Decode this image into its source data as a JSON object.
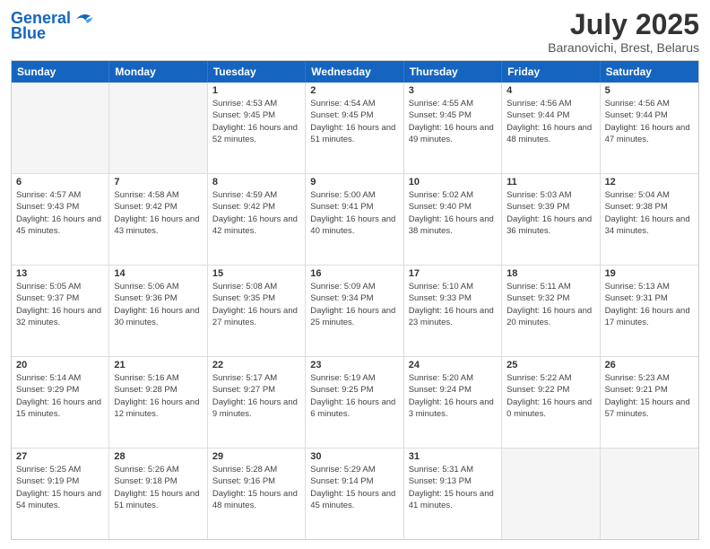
{
  "header": {
    "logo_line1": "General",
    "logo_line2": "Blue",
    "title": "July 2025",
    "subtitle": "Baranovichi, Brest, Belarus"
  },
  "weekdays": [
    "Sunday",
    "Monday",
    "Tuesday",
    "Wednesday",
    "Thursday",
    "Friday",
    "Saturday"
  ],
  "rows": [
    [
      {
        "day": "",
        "sunrise": "",
        "sunset": "",
        "daylight": "",
        "empty": true
      },
      {
        "day": "",
        "sunrise": "",
        "sunset": "",
        "daylight": "",
        "empty": true
      },
      {
        "day": "1",
        "sunrise": "Sunrise: 4:53 AM",
        "sunset": "Sunset: 9:45 PM",
        "daylight": "Daylight: 16 hours and 52 minutes."
      },
      {
        "day": "2",
        "sunrise": "Sunrise: 4:54 AM",
        "sunset": "Sunset: 9:45 PM",
        "daylight": "Daylight: 16 hours and 51 minutes."
      },
      {
        "day": "3",
        "sunrise": "Sunrise: 4:55 AM",
        "sunset": "Sunset: 9:45 PM",
        "daylight": "Daylight: 16 hours and 49 minutes."
      },
      {
        "day": "4",
        "sunrise": "Sunrise: 4:56 AM",
        "sunset": "Sunset: 9:44 PM",
        "daylight": "Daylight: 16 hours and 48 minutes."
      },
      {
        "day": "5",
        "sunrise": "Sunrise: 4:56 AM",
        "sunset": "Sunset: 9:44 PM",
        "daylight": "Daylight: 16 hours and 47 minutes."
      }
    ],
    [
      {
        "day": "6",
        "sunrise": "Sunrise: 4:57 AM",
        "sunset": "Sunset: 9:43 PM",
        "daylight": "Daylight: 16 hours and 45 minutes."
      },
      {
        "day": "7",
        "sunrise": "Sunrise: 4:58 AM",
        "sunset": "Sunset: 9:42 PM",
        "daylight": "Daylight: 16 hours and 43 minutes."
      },
      {
        "day": "8",
        "sunrise": "Sunrise: 4:59 AM",
        "sunset": "Sunset: 9:42 PM",
        "daylight": "Daylight: 16 hours and 42 minutes."
      },
      {
        "day": "9",
        "sunrise": "Sunrise: 5:00 AM",
        "sunset": "Sunset: 9:41 PM",
        "daylight": "Daylight: 16 hours and 40 minutes."
      },
      {
        "day": "10",
        "sunrise": "Sunrise: 5:02 AM",
        "sunset": "Sunset: 9:40 PM",
        "daylight": "Daylight: 16 hours and 38 minutes."
      },
      {
        "day": "11",
        "sunrise": "Sunrise: 5:03 AM",
        "sunset": "Sunset: 9:39 PM",
        "daylight": "Daylight: 16 hours and 36 minutes."
      },
      {
        "day": "12",
        "sunrise": "Sunrise: 5:04 AM",
        "sunset": "Sunset: 9:38 PM",
        "daylight": "Daylight: 16 hours and 34 minutes."
      }
    ],
    [
      {
        "day": "13",
        "sunrise": "Sunrise: 5:05 AM",
        "sunset": "Sunset: 9:37 PM",
        "daylight": "Daylight: 16 hours and 32 minutes."
      },
      {
        "day": "14",
        "sunrise": "Sunrise: 5:06 AM",
        "sunset": "Sunset: 9:36 PM",
        "daylight": "Daylight: 16 hours and 30 minutes."
      },
      {
        "day": "15",
        "sunrise": "Sunrise: 5:08 AM",
        "sunset": "Sunset: 9:35 PM",
        "daylight": "Daylight: 16 hours and 27 minutes."
      },
      {
        "day": "16",
        "sunrise": "Sunrise: 5:09 AM",
        "sunset": "Sunset: 9:34 PM",
        "daylight": "Daylight: 16 hours and 25 minutes."
      },
      {
        "day": "17",
        "sunrise": "Sunrise: 5:10 AM",
        "sunset": "Sunset: 9:33 PM",
        "daylight": "Daylight: 16 hours and 23 minutes."
      },
      {
        "day": "18",
        "sunrise": "Sunrise: 5:11 AM",
        "sunset": "Sunset: 9:32 PM",
        "daylight": "Daylight: 16 hours and 20 minutes."
      },
      {
        "day": "19",
        "sunrise": "Sunrise: 5:13 AM",
        "sunset": "Sunset: 9:31 PM",
        "daylight": "Daylight: 16 hours and 17 minutes."
      }
    ],
    [
      {
        "day": "20",
        "sunrise": "Sunrise: 5:14 AM",
        "sunset": "Sunset: 9:29 PM",
        "daylight": "Daylight: 16 hours and 15 minutes."
      },
      {
        "day": "21",
        "sunrise": "Sunrise: 5:16 AM",
        "sunset": "Sunset: 9:28 PM",
        "daylight": "Daylight: 16 hours and 12 minutes."
      },
      {
        "day": "22",
        "sunrise": "Sunrise: 5:17 AM",
        "sunset": "Sunset: 9:27 PM",
        "daylight": "Daylight: 16 hours and 9 minutes."
      },
      {
        "day": "23",
        "sunrise": "Sunrise: 5:19 AM",
        "sunset": "Sunset: 9:25 PM",
        "daylight": "Daylight: 16 hours and 6 minutes."
      },
      {
        "day": "24",
        "sunrise": "Sunrise: 5:20 AM",
        "sunset": "Sunset: 9:24 PM",
        "daylight": "Daylight: 16 hours and 3 minutes."
      },
      {
        "day": "25",
        "sunrise": "Sunrise: 5:22 AM",
        "sunset": "Sunset: 9:22 PM",
        "daylight": "Daylight: 16 hours and 0 minutes."
      },
      {
        "day": "26",
        "sunrise": "Sunrise: 5:23 AM",
        "sunset": "Sunset: 9:21 PM",
        "daylight": "Daylight: 15 hours and 57 minutes."
      }
    ],
    [
      {
        "day": "27",
        "sunrise": "Sunrise: 5:25 AM",
        "sunset": "Sunset: 9:19 PM",
        "daylight": "Daylight: 15 hours and 54 minutes."
      },
      {
        "day": "28",
        "sunrise": "Sunrise: 5:26 AM",
        "sunset": "Sunset: 9:18 PM",
        "daylight": "Daylight: 15 hours and 51 minutes."
      },
      {
        "day": "29",
        "sunrise": "Sunrise: 5:28 AM",
        "sunset": "Sunset: 9:16 PM",
        "daylight": "Daylight: 15 hours and 48 minutes."
      },
      {
        "day": "30",
        "sunrise": "Sunrise: 5:29 AM",
        "sunset": "Sunset: 9:14 PM",
        "daylight": "Daylight: 15 hours and 45 minutes."
      },
      {
        "day": "31",
        "sunrise": "Sunrise: 5:31 AM",
        "sunset": "Sunset: 9:13 PM",
        "daylight": "Daylight: 15 hours and 41 minutes."
      },
      {
        "day": "",
        "sunrise": "",
        "sunset": "",
        "daylight": "",
        "empty": true
      },
      {
        "day": "",
        "sunrise": "",
        "sunset": "",
        "daylight": "",
        "empty": true
      }
    ]
  ]
}
